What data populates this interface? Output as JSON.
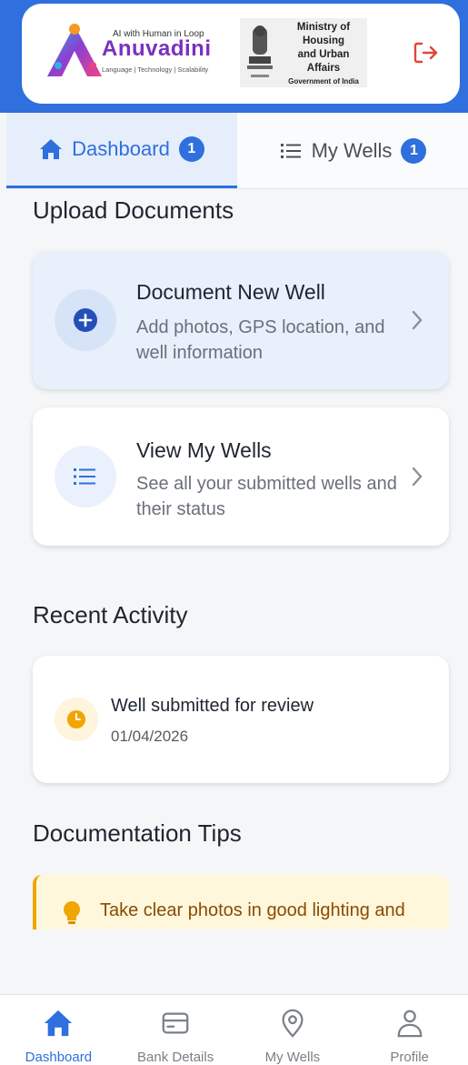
{
  "header": {
    "brand_tagline": "AI with Human in Loop",
    "brand_name": "Anuvadini",
    "brand_sub": "Language | Technology | Scalability",
    "ministry_line1": "Ministry of Housing",
    "ministry_line2": "and Urban Affairs",
    "ministry_line3": "Government of India"
  },
  "tabs": [
    {
      "label": "Dashboard",
      "badge": "1"
    },
    {
      "label": "My Wells",
      "badge": "1"
    }
  ],
  "upload": {
    "title": "Upload Documents",
    "cards": [
      {
        "title": "Document New Well",
        "desc": "Add photos, GPS location, and well information"
      },
      {
        "title": "View My Wells",
        "desc": "See all your submitted wells and their status"
      }
    ]
  },
  "activity": {
    "title": "Recent Activity",
    "items": [
      {
        "title": "Well submitted for review",
        "date": "01/04/2026"
      }
    ]
  },
  "tips": {
    "title": "Documentation Tips",
    "items": [
      "Take clear photos in good lighting and"
    ]
  },
  "nav": [
    {
      "label": "Dashboard"
    },
    {
      "label": "Bank Details"
    },
    {
      "label": "My Wells"
    },
    {
      "label": "Profile"
    }
  ],
  "colors": {
    "primary": "#2f6fde",
    "warning": "#f0a500",
    "logout": "#e0453a"
  }
}
